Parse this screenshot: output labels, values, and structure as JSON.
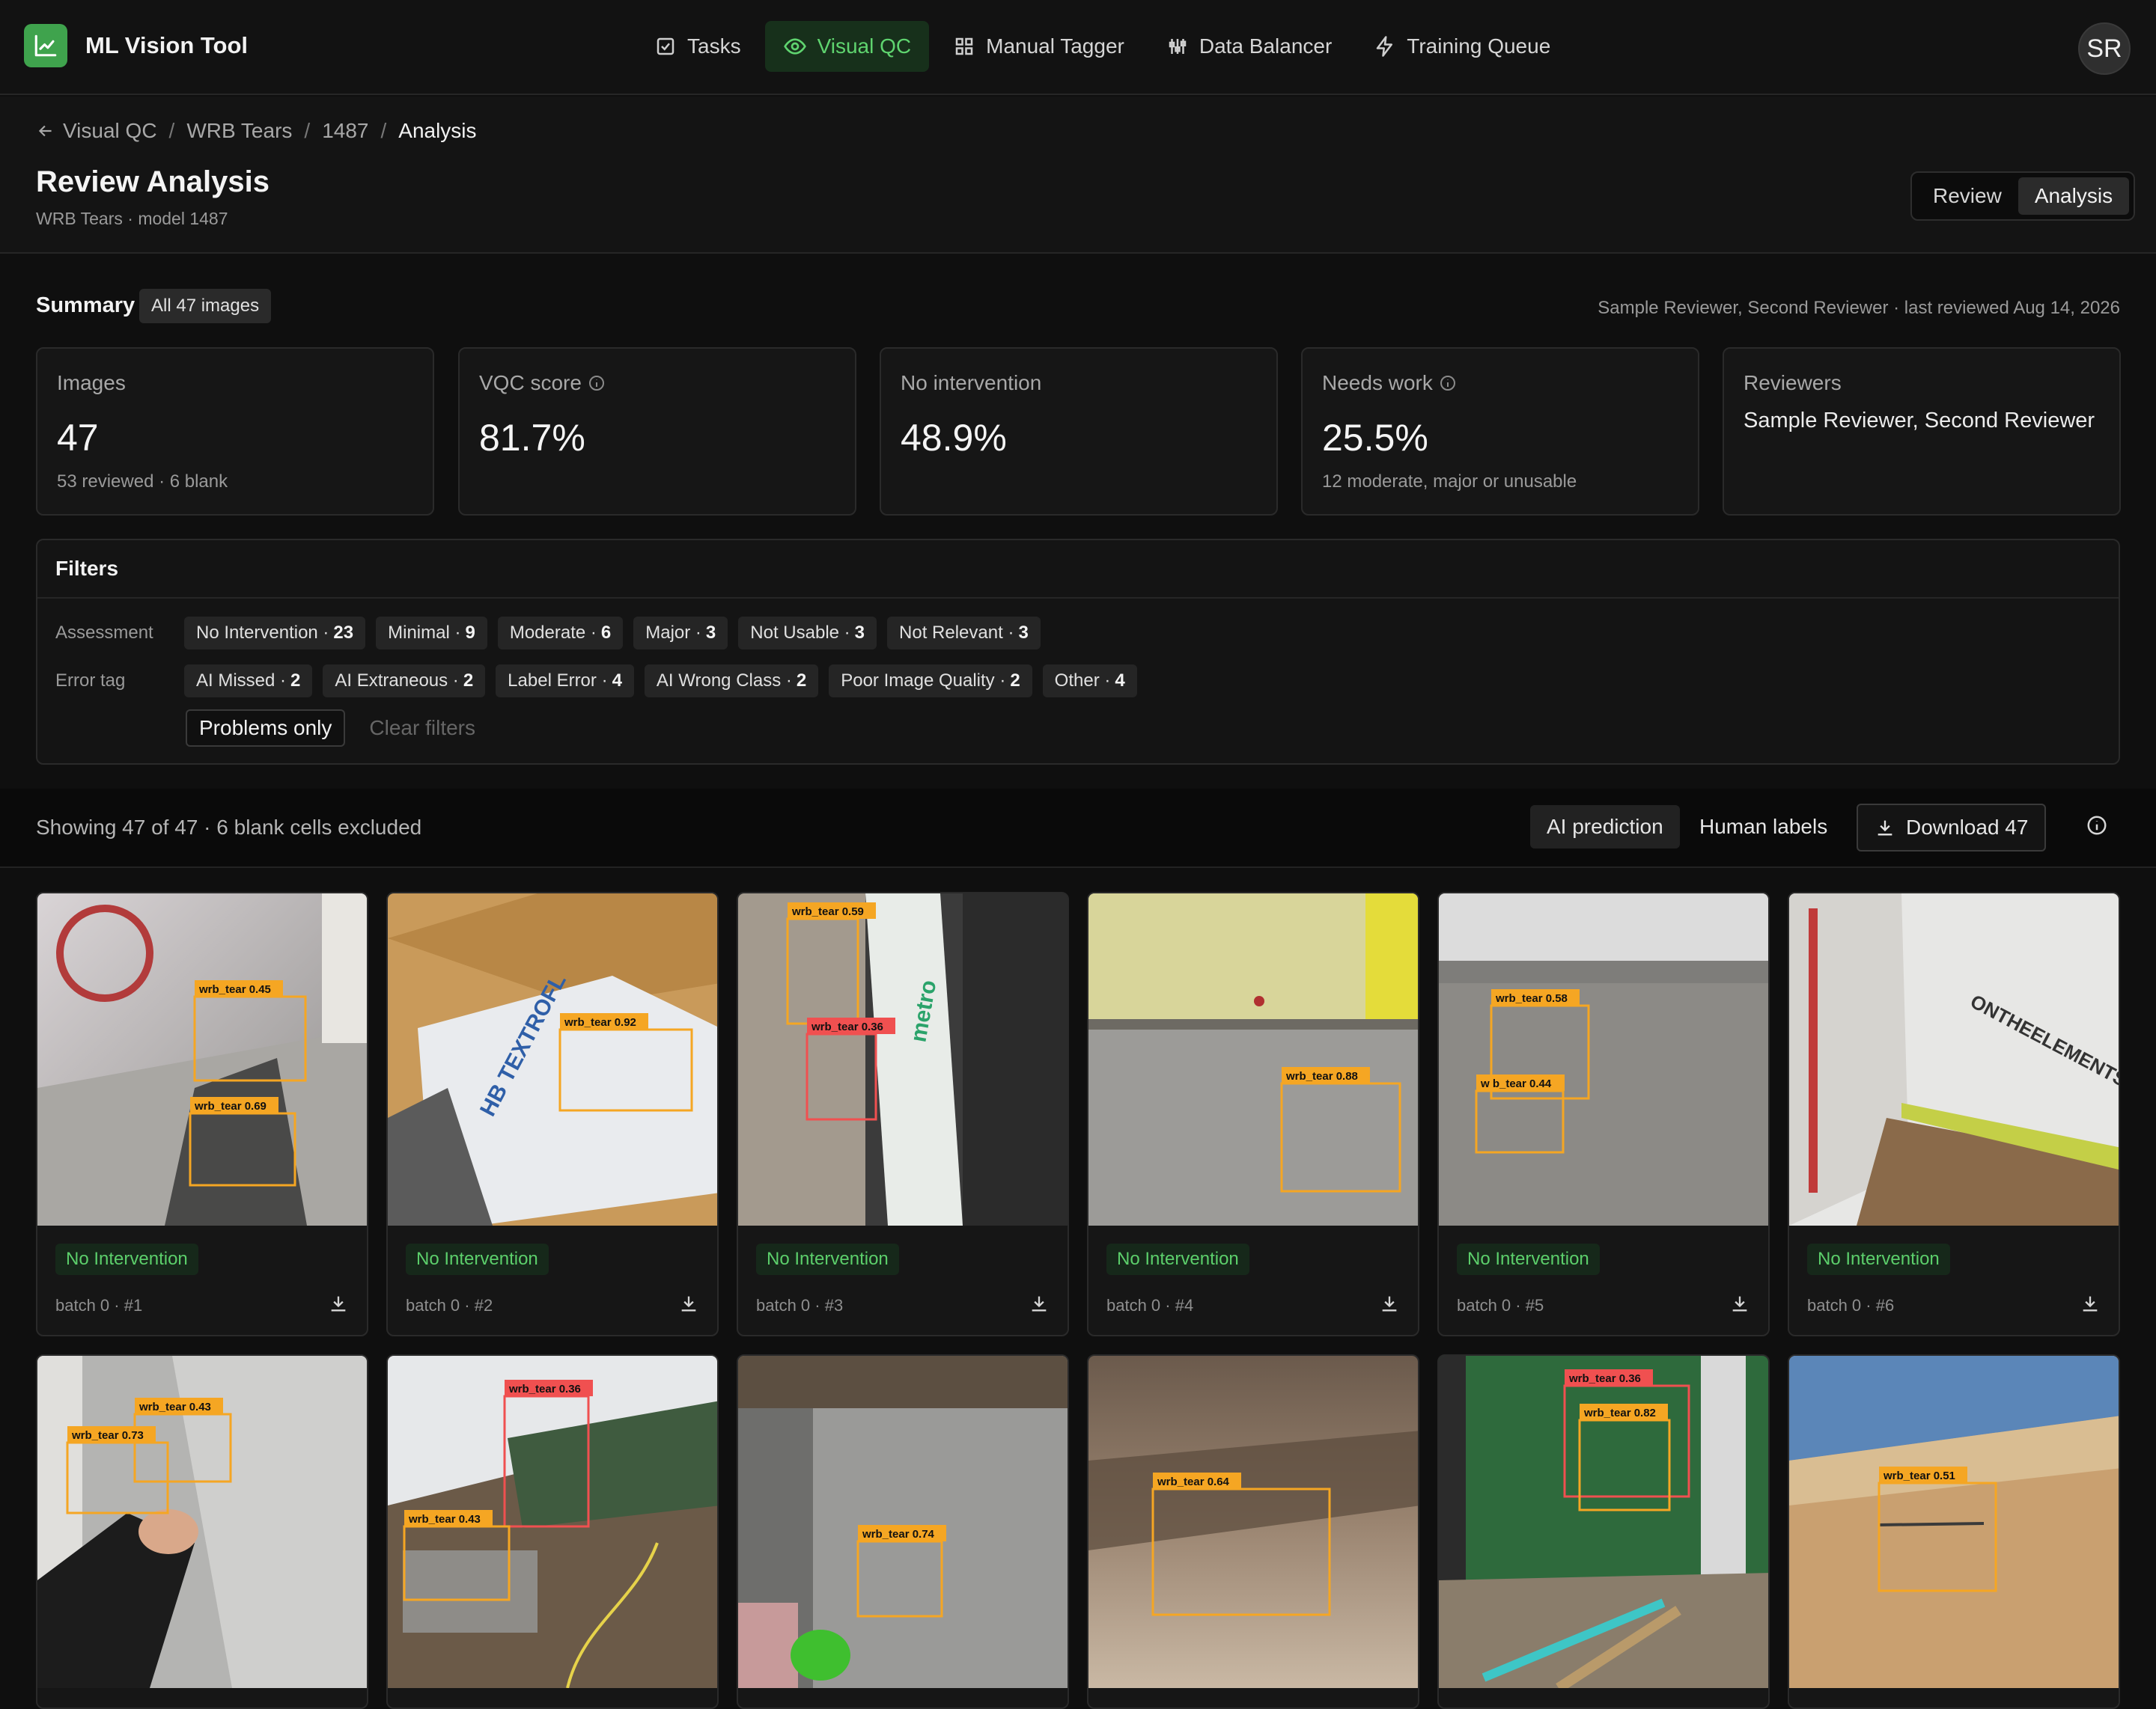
{
  "app": {
    "name": "ML Vision Tool",
    "avatar_initials": "SR",
    "accent": "#3fa34d"
  },
  "nav": {
    "tabs": [
      {
        "label": "Tasks",
        "icon": "checkbox-icon"
      },
      {
        "label": "Visual QC",
        "icon": "eye-icon",
        "active": true
      },
      {
        "label": "Manual Tagger",
        "icon": "grid-icon"
      },
      {
        "label": "Data Balancer",
        "icon": "sliders-icon"
      },
      {
        "label": "Training Queue",
        "icon": "bolt-icon"
      }
    ]
  },
  "breadcrumb": {
    "items": [
      "Visual QC",
      "WRB Tears",
      "1487"
    ],
    "current": "Analysis"
  },
  "header": {
    "title": "Review Analysis",
    "subtitle": "WRB Tears · model 1487",
    "toggle": [
      "Review",
      "Analysis"
    ],
    "toggle_active": "Analysis"
  },
  "summary": {
    "label": "Summary",
    "scope": "All 47 images",
    "meta": "Sample Reviewer, Second Reviewer · last reviewed Aug 14, 2026",
    "stats": [
      {
        "label": "Images",
        "value": "47",
        "sub": "53 reviewed · 6 blank"
      },
      {
        "label": "VQC score",
        "value": "81.7%",
        "sub": ""
      },
      {
        "label": "No intervention",
        "value": "48.9%",
        "sub": ""
      },
      {
        "label": "Needs work",
        "value": "25.5%",
        "sub": "12 moderate, major or unusable"
      },
      {
        "label": "Reviewers",
        "text": "Sample Reviewer, Second Reviewer"
      }
    ]
  },
  "filters": {
    "title": "Filters",
    "assessment_label": "Assessment",
    "assessment": [
      {
        "label": "No Intervention ·",
        "count": "23"
      },
      {
        "label": "Minimal ·",
        "count": "9"
      },
      {
        "label": "Moderate ·",
        "count": "6"
      },
      {
        "label": "Major ·",
        "count": "3"
      },
      {
        "label": "Not Usable ·",
        "count": "3"
      },
      {
        "label": "Not Relevant ·",
        "count": "3"
      }
    ],
    "error_label": "Error tag",
    "errors": [
      {
        "label": "AI Missed ·",
        "count": "2"
      },
      {
        "label": "AI Extraneous ·",
        "count": "2"
      },
      {
        "label": "Label Error ·",
        "count": "4"
      },
      {
        "label": "AI Wrong Class ·",
        "count": "2"
      },
      {
        "label": "Poor Image Quality ·",
        "count": "2"
      },
      {
        "label": "Other ·",
        "count": "4"
      }
    ],
    "problems_only": "Problems only",
    "clear": "Clear filters"
  },
  "results": {
    "showing": "Showing 47 of 47 · 6 blank cells excluded",
    "view_ai": "AI prediction",
    "view_human": "Human labels",
    "download": "Download 47"
  },
  "gallery": [
    {
      "status": "No Intervention",
      "meta": "batch 0 · #1",
      "boxes": [
        {
          "label": "wrb_tear 0.45",
          "color": "#f5a623"
        },
        {
          "label": "wrb_tear 0.69",
          "color": "#f5a623"
        }
      ]
    },
    {
      "status": "No Intervention",
      "meta": "batch 0 · #2",
      "boxes": [
        {
          "label": "wrb_tear 0.92",
          "color": "#f5a623"
        }
      ]
    },
    {
      "status": "No Intervention",
      "meta": "batch 0 · #3",
      "boxes": [
        {
          "label": "wrb_tear 0.59",
          "color": "#f5a623"
        },
        {
          "label": "wrb_tear 0.36",
          "color": "#f05050"
        }
      ]
    },
    {
      "status": "No Intervention",
      "meta": "batch 0 · #4",
      "boxes": [
        {
          "label": "wrb_tear 0.88",
          "color": "#f5a623"
        }
      ]
    },
    {
      "status": "No Intervention",
      "meta": "batch 0 · #5",
      "boxes": [
        {
          "label": "wrb_tear 0.58",
          "color": "#f5a623"
        },
        {
          "label": "w b_tear 0.44",
          "color": "#f5a623"
        }
      ]
    },
    {
      "status": "No Intervention",
      "meta": "batch 0 · #6",
      "boxes": []
    },
    {
      "boxes": [
        {
          "label": "wrb_tear 0.43",
          "color": "#f5a623"
        },
        {
          "label": "wrb_tear 0.73",
          "color": "#f5a623"
        }
      ]
    },
    {
      "boxes": [
        {
          "label": "wrb_tear 0.36",
          "color": "#f05050"
        },
        {
          "label": "wrb_tear 0.43",
          "color": "#f5a623"
        }
      ]
    },
    {
      "boxes": [
        {
          "label": "wrb_tear 0.74",
          "color": "#f5a623"
        }
      ]
    },
    {
      "boxes": [
        {
          "label": "wrb_tear 0.64",
          "color": "#f5a623"
        }
      ]
    },
    {
      "boxes": [
        {
          "label": "wrb_tear 0.36",
          "color": "#f05050"
        },
        {
          "label": "wrb_tear 0.82",
          "color": "#f5a623"
        }
      ]
    },
    {
      "boxes": [
        {
          "label": "wrb_tear 0.51",
          "color": "#f5a623"
        }
      ]
    }
  ]
}
